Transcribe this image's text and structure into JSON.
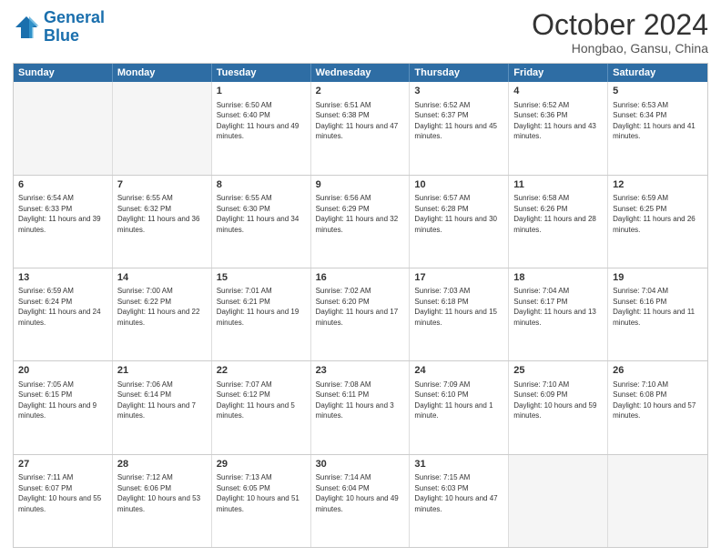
{
  "header": {
    "logo_general": "General",
    "logo_blue": "Blue",
    "month": "October 2024",
    "location": "Hongbao, Gansu, China"
  },
  "days_of_week": [
    "Sunday",
    "Monday",
    "Tuesday",
    "Wednesday",
    "Thursday",
    "Friday",
    "Saturday"
  ],
  "rows": [
    [
      {
        "day": "",
        "sunrise": "",
        "sunset": "",
        "daylight": "",
        "empty": true
      },
      {
        "day": "",
        "sunrise": "",
        "sunset": "",
        "daylight": "",
        "empty": true
      },
      {
        "day": "1",
        "sunrise": "Sunrise: 6:50 AM",
        "sunset": "Sunset: 6:40 PM",
        "daylight": "Daylight: 11 hours and 49 minutes."
      },
      {
        "day": "2",
        "sunrise": "Sunrise: 6:51 AM",
        "sunset": "Sunset: 6:38 PM",
        "daylight": "Daylight: 11 hours and 47 minutes."
      },
      {
        "day": "3",
        "sunrise": "Sunrise: 6:52 AM",
        "sunset": "Sunset: 6:37 PM",
        "daylight": "Daylight: 11 hours and 45 minutes."
      },
      {
        "day": "4",
        "sunrise": "Sunrise: 6:52 AM",
        "sunset": "Sunset: 6:36 PM",
        "daylight": "Daylight: 11 hours and 43 minutes."
      },
      {
        "day": "5",
        "sunrise": "Sunrise: 6:53 AM",
        "sunset": "Sunset: 6:34 PM",
        "daylight": "Daylight: 11 hours and 41 minutes."
      }
    ],
    [
      {
        "day": "6",
        "sunrise": "Sunrise: 6:54 AM",
        "sunset": "Sunset: 6:33 PM",
        "daylight": "Daylight: 11 hours and 39 minutes."
      },
      {
        "day": "7",
        "sunrise": "Sunrise: 6:55 AM",
        "sunset": "Sunset: 6:32 PM",
        "daylight": "Daylight: 11 hours and 36 minutes."
      },
      {
        "day": "8",
        "sunrise": "Sunrise: 6:55 AM",
        "sunset": "Sunset: 6:30 PM",
        "daylight": "Daylight: 11 hours and 34 minutes."
      },
      {
        "day": "9",
        "sunrise": "Sunrise: 6:56 AM",
        "sunset": "Sunset: 6:29 PM",
        "daylight": "Daylight: 11 hours and 32 minutes."
      },
      {
        "day": "10",
        "sunrise": "Sunrise: 6:57 AM",
        "sunset": "Sunset: 6:28 PM",
        "daylight": "Daylight: 11 hours and 30 minutes."
      },
      {
        "day": "11",
        "sunrise": "Sunrise: 6:58 AM",
        "sunset": "Sunset: 6:26 PM",
        "daylight": "Daylight: 11 hours and 28 minutes."
      },
      {
        "day": "12",
        "sunrise": "Sunrise: 6:59 AM",
        "sunset": "Sunset: 6:25 PM",
        "daylight": "Daylight: 11 hours and 26 minutes."
      }
    ],
    [
      {
        "day": "13",
        "sunrise": "Sunrise: 6:59 AM",
        "sunset": "Sunset: 6:24 PM",
        "daylight": "Daylight: 11 hours and 24 minutes."
      },
      {
        "day": "14",
        "sunrise": "Sunrise: 7:00 AM",
        "sunset": "Sunset: 6:22 PM",
        "daylight": "Daylight: 11 hours and 22 minutes."
      },
      {
        "day": "15",
        "sunrise": "Sunrise: 7:01 AM",
        "sunset": "Sunset: 6:21 PM",
        "daylight": "Daylight: 11 hours and 19 minutes."
      },
      {
        "day": "16",
        "sunrise": "Sunrise: 7:02 AM",
        "sunset": "Sunset: 6:20 PM",
        "daylight": "Daylight: 11 hours and 17 minutes."
      },
      {
        "day": "17",
        "sunrise": "Sunrise: 7:03 AM",
        "sunset": "Sunset: 6:18 PM",
        "daylight": "Daylight: 11 hours and 15 minutes."
      },
      {
        "day": "18",
        "sunrise": "Sunrise: 7:04 AM",
        "sunset": "Sunset: 6:17 PM",
        "daylight": "Daylight: 11 hours and 13 minutes."
      },
      {
        "day": "19",
        "sunrise": "Sunrise: 7:04 AM",
        "sunset": "Sunset: 6:16 PM",
        "daylight": "Daylight: 11 hours and 11 minutes."
      }
    ],
    [
      {
        "day": "20",
        "sunrise": "Sunrise: 7:05 AM",
        "sunset": "Sunset: 6:15 PM",
        "daylight": "Daylight: 11 hours and 9 minutes."
      },
      {
        "day": "21",
        "sunrise": "Sunrise: 7:06 AM",
        "sunset": "Sunset: 6:14 PM",
        "daylight": "Daylight: 11 hours and 7 minutes."
      },
      {
        "day": "22",
        "sunrise": "Sunrise: 7:07 AM",
        "sunset": "Sunset: 6:12 PM",
        "daylight": "Daylight: 11 hours and 5 minutes."
      },
      {
        "day": "23",
        "sunrise": "Sunrise: 7:08 AM",
        "sunset": "Sunset: 6:11 PM",
        "daylight": "Daylight: 11 hours and 3 minutes."
      },
      {
        "day": "24",
        "sunrise": "Sunrise: 7:09 AM",
        "sunset": "Sunset: 6:10 PM",
        "daylight": "Daylight: 11 hours and 1 minute."
      },
      {
        "day": "25",
        "sunrise": "Sunrise: 7:10 AM",
        "sunset": "Sunset: 6:09 PM",
        "daylight": "Daylight: 10 hours and 59 minutes."
      },
      {
        "day": "26",
        "sunrise": "Sunrise: 7:10 AM",
        "sunset": "Sunset: 6:08 PM",
        "daylight": "Daylight: 10 hours and 57 minutes."
      }
    ],
    [
      {
        "day": "27",
        "sunrise": "Sunrise: 7:11 AM",
        "sunset": "Sunset: 6:07 PM",
        "daylight": "Daylight: 10 hours and 55 minutes."
      },
      {
        "day": "28",
        "sunrise": "Sunrise: 7:12 AM",
        "sunset": "Sunset: 6:06 PM",
        "daylight": "Daylight: 10 hours and 53 minutes."
      },
      {
        "day": "29",
        "sunrise": "Sunrise: 7:13 AM",
        "sunset": "Sunset: 6:05 PM",
        "daylight": "Daylight: 10 hours and 51 minutes."
      },
      {
        "day": "30",
        "sunrise": "Sunrise: 7:14 AM",
        "sunset": "Sunset: 6:04 PM",
        "daylight": "Daylight: 10 hours and 49 minutes."
      },
      {
        "day": "31",
        "sunrise": "Sunrise: 7:15 AM",
        "sunset": "Sunset: 6:03 PM",
        "daylight": "Daylight: 10 hours and 47 minutes."
      },
      {
        "day": "",
        "sunrise": "",
        "sunset": "",
        "daylight": "",
        "empty": true
      },
      {
        "day": "",
        "sunrise": "",
        "sunset": "",
        "daylight": "",
        "empty": true
      }
    ]
  ]
}
